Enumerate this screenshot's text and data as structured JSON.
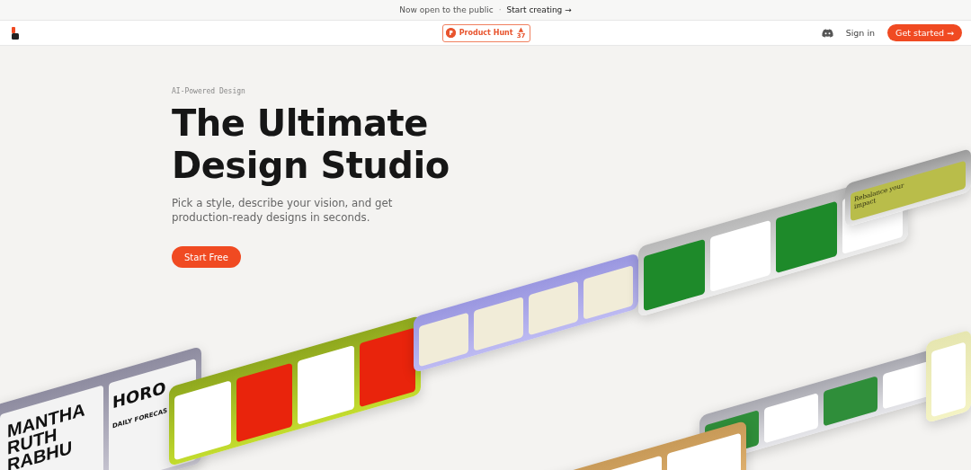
{
  "announcement": {
    "text": "Now open to the public",
    "separator": "·",
    "link": "Start creating →"
  },
  "nav": {
    "badge": {
      "name": "Product Hunt",
      "arrow": "▲",
      "votes": "37"
    },
    "sign_in": "Sign in",
    "cta": "Get started →"
  },
  "hero": {
    "eyebrow": "AI-Powered Design",
    "title_lines": [
      "The Ultimate",
      "Design Studio"
    ],
    "subtitle": "Pick a style, describe your vision, and get production-ready designs in seconds.",
    "button": "Start Free"
  },
  "showcase": [
    {
      "kind": "editorial",
      "texts": [
        "MANTHA RUTH RABHU",
        "HORO",
        "DAILY FORECAS"
      ]
    },
    {
      "kind": "lime"
    },
    {
      "kind": "lavender"
    },
    {
      "kind": "green"
    },
    {
      "kind": "quote",
      "texts": [
        "Rebalance your impact"
      ]
    },
    {
      "kind": "grocery"
    },
    {
      "kind": "tan"
    },
    {
      "kind": "yellow"
    }
  ]
}
